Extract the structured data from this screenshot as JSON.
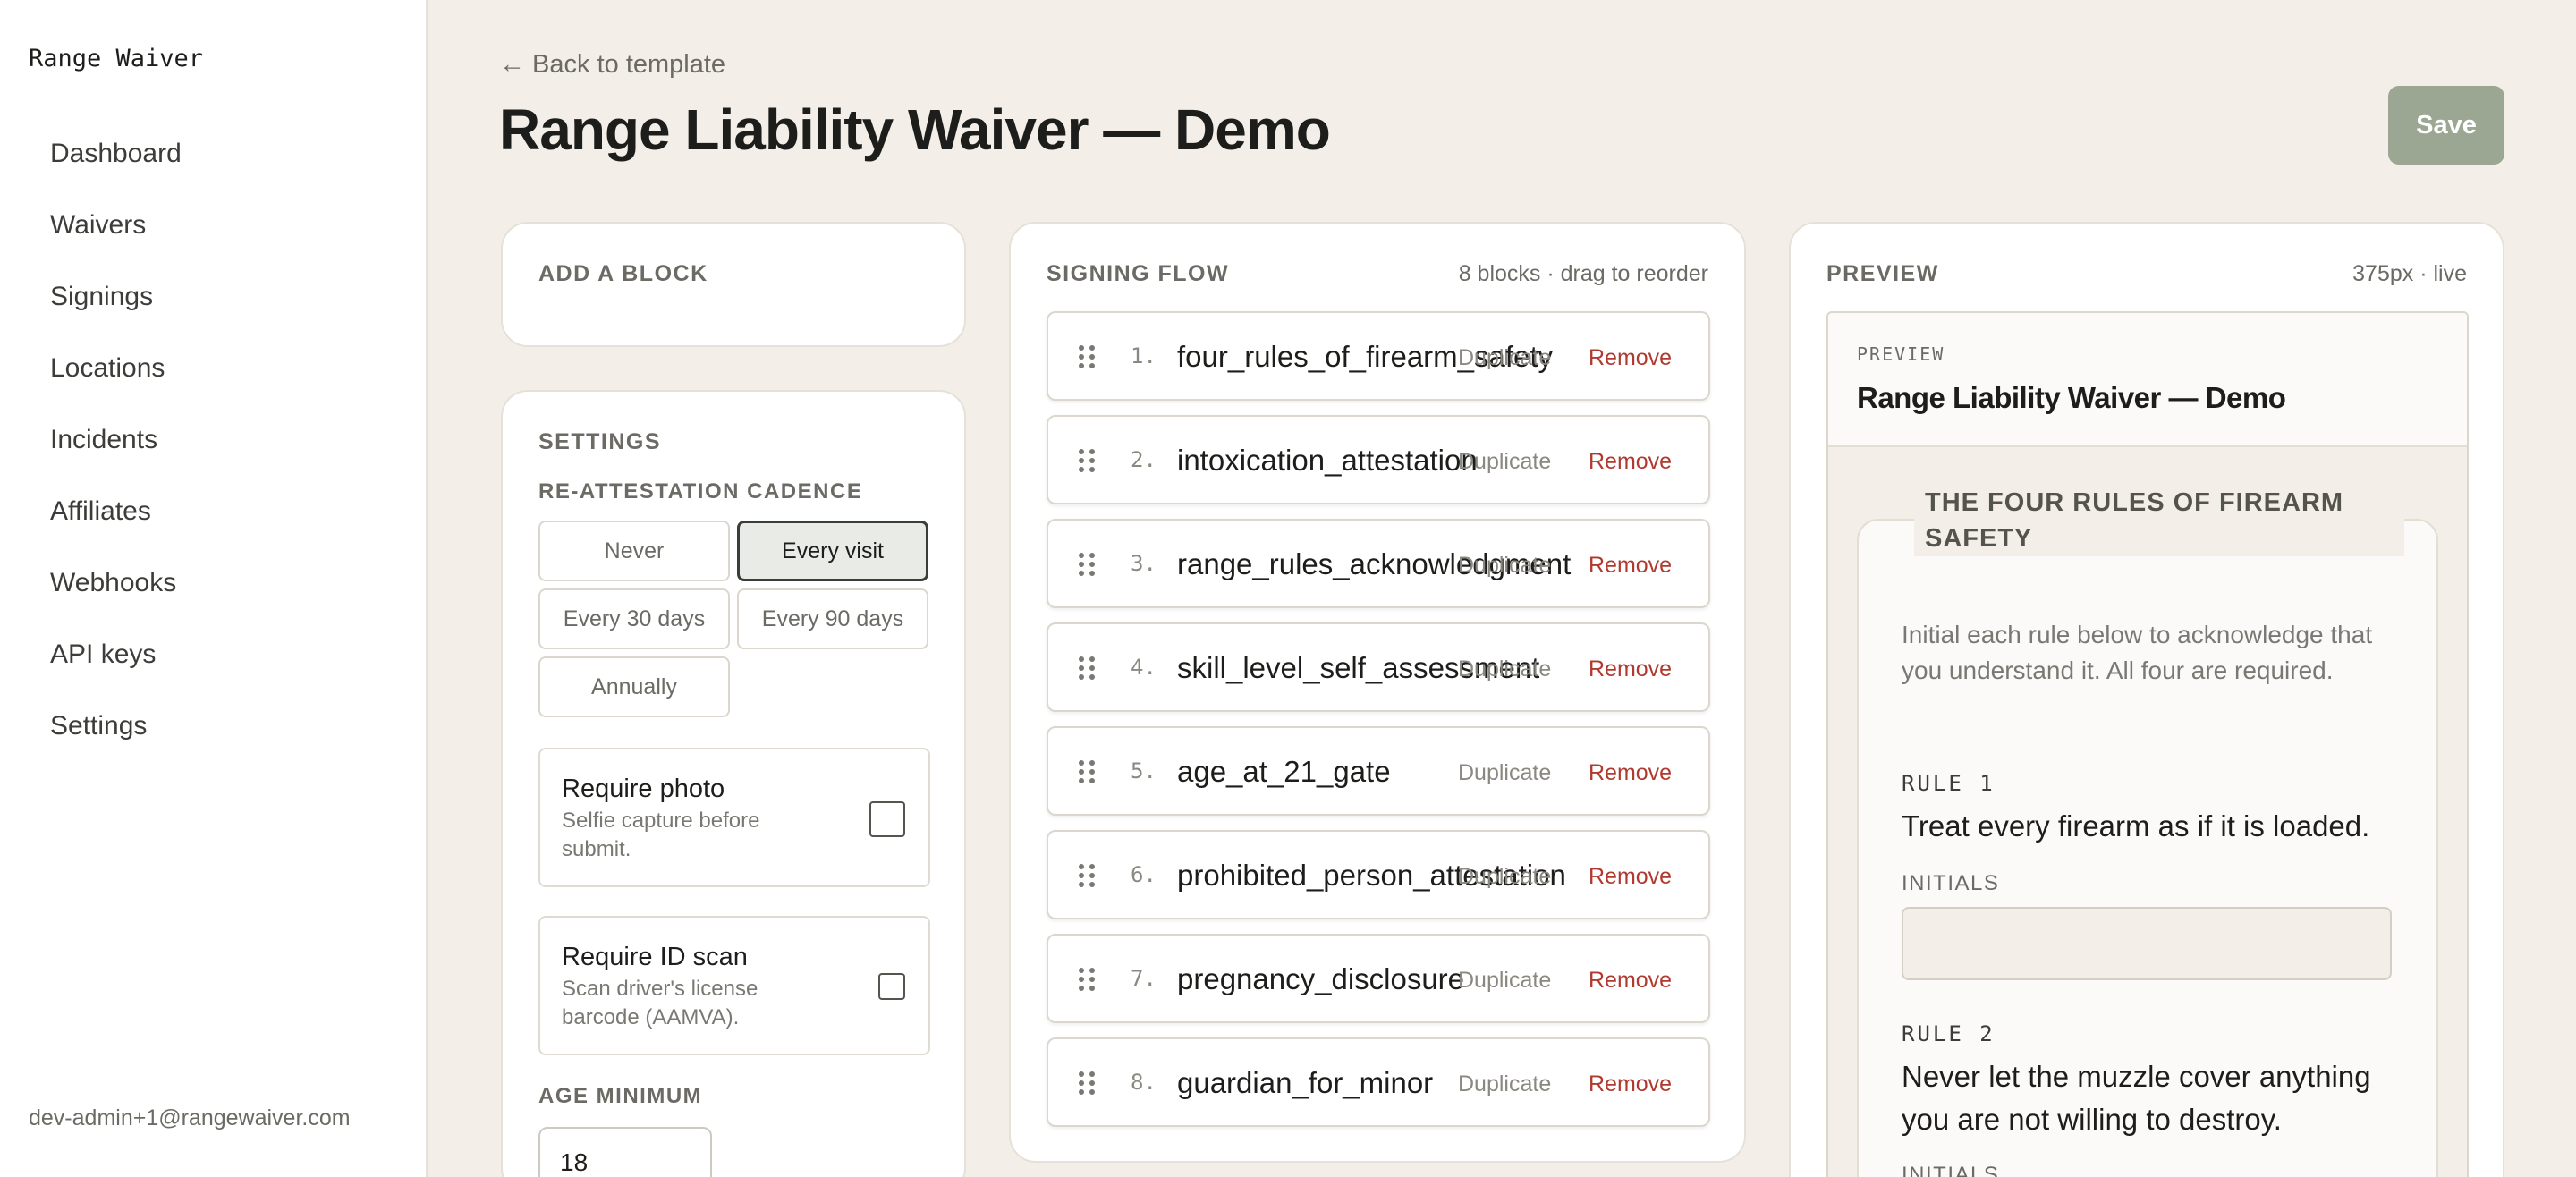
{
  "app": {
    "brand": "Range Waiver",
    "user_email": "dev-admin+1@rangewaiver.com"
  },
  "sidebar": {
    "items": [
      {
        "label": "Dashboard"
      },
      {
        "label": "Waivers"
      },
      {
        "label": "Signings"
      },
      {
        "label": "Locations"
      },
      {
        "label": "Incidents"
      },
      {
        "label": "Affiliates"
      },
      {
        "label": "Webhooks"
      },
      {
        "label": "API keys"
      },
      {
        "label": "Settings"
      }
    ]
  },
  "header": {
    "back_label": "← Back to template",
    "title": "Range Liability Waiver — Demo",
    "save_label": "Save"
  },
  "add_block": {
    "heading": "ADD A BLOCK"
  },
  "settings": {
    "heading": "SETTINGS",
    "cadence_label": "RE-ATTESTATION CADENCE",
    "cadence_options": [
      {
        "label": "Never",
        "selected": false
      },
      {
        "label": "Every visit",
        "selected": true
      },
      {
        "label": "Every 30 days",
        "selected": false
      },
      {
        "label": "Every 90 days",
        "selected": false
      },
      {
        "label": "Annually",
        "selected": false
      }
    ],
    "require_photo": {
      "title": "Require photo",
      "description": "Selfie capture before submit.",
      "checked": false
    },
    "require_id": {
      "title": "Require ID scan",
      "description": "Scan driver's license barcode (AAMVA).",
      "checked": false
    },
    "age_label": "AGE MINIMUM",
    "age_value": "18"
  },
  "flow": {
    "heading": "SIGNING FLOW",
    "meta": "8 blocks · drag to reorder",
    "duplicate_label": "Duplicate",
    "remove_label": "Remove",
    "blocks": [
      {
        "num": "1.",
        "name": "four_rules_of_firearm_safety"
      },
      {
        "num": "2.",
        "name": "intoxication_attestation"
      },
      {
        "num": "3.",
        "name": "range_rules_acknowledgment"
      },
      {
        "num": "4.",
        "name": "skill_level_self_assessment"
      },
      {
        "num": "5.",
        "name": "age_at_21_gate"
      },
      {
        "num": "6.",
        "name": "prohibited_person_attestation"
      },
      {
        "num": "7.",
        "name": "pregnancy_disclosure"
      },
      {
        "num": "8.",
        "name": "guardian_for_minor"
      }
    ]
  },
  "preview": {
    "heading": "PREVIEW",
    "meta": "375px · live",
    "eyebrow": "PREVIEW",
    "title": "Range Liability Waiver — Demo",
    "section_title": "THE FOUR RULES OF FIREARM SAFETY",
    "intro": "Initial each rule below to acknowledge that you understand it. All four are required.",
    "initials_label": "INITIALS",
    "rules": [
      {
        "label": "RULE 1",
        "text": "Treat every firearm as if it is loaded."
      },
      {
        "label": "RULE 2",
        "text": "Never let the muzzle cover anything you are not willing to destroy."
      }
    ]
  }
}
